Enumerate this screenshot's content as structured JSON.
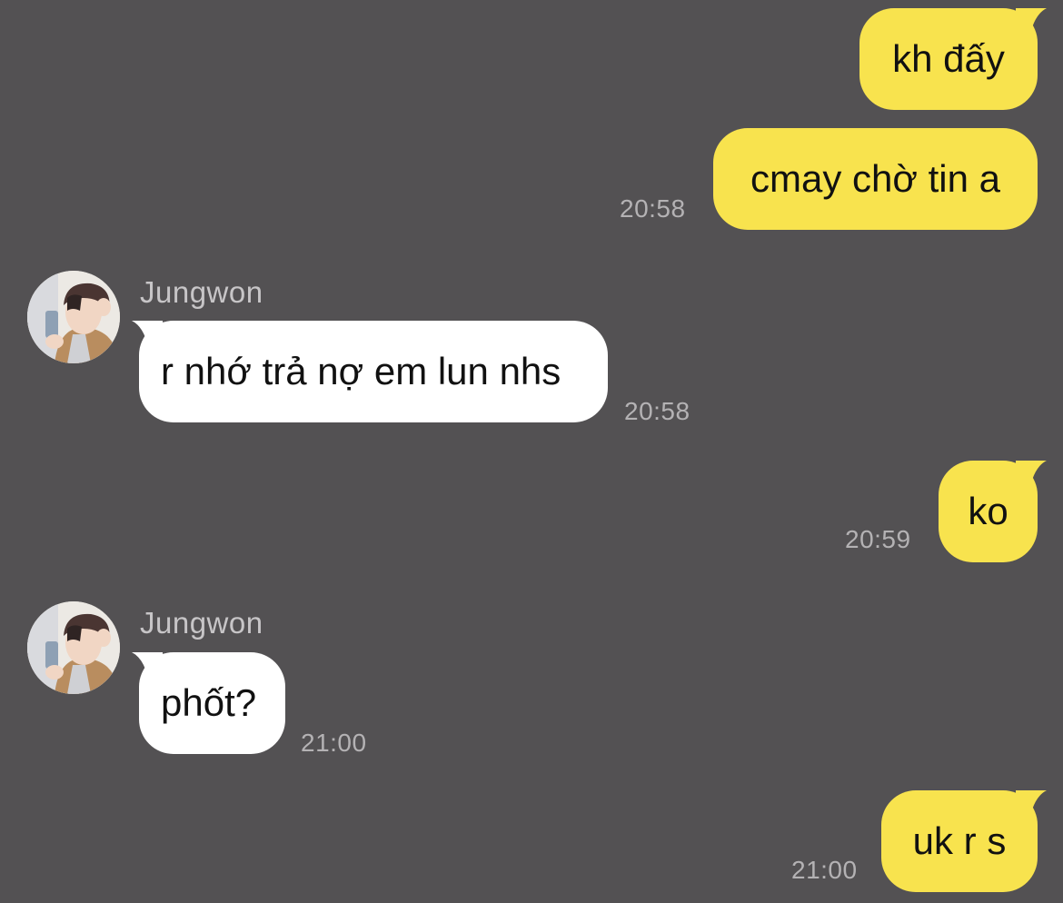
{
  "colors": {
    "background": "#535153",
    "outgoing_bubble": "#f8e34e",
    "incoming_bubble": "#ffffff",
    "timestamp": "#b4b2b4",
    "sender_name": "#c7c5c7"
  },
  "messages": [
    {
      "direction": "outgoing",
      "text": "kh đấy",
      "time": ""
    },
    {
      "direction": "outgoing",
      "text": "cmay chờ tin a",
      "time": "20:58"
    },
    {
      "direction": "incoming",
      "sender": "Jungwon",
      "avatar_icon": "profile-photo",
      "text": "r nhớ trả nợ em lun nhs",
      "time": "20:58"
    },
    {
      "direction": "outgoing",
      "text": "ko",
      "time": "20:59"
    },
    {
      "direction": "incoming",
      "sender": "Jungwon",
      "avatar_icon": "profile-photo",
      "text": "phốt?",
      "time": "21:00"
    },
    {
      "direction": "outgoing",
      "text": "uk r s",
      "time": "21:00"
    }
  ]
}
